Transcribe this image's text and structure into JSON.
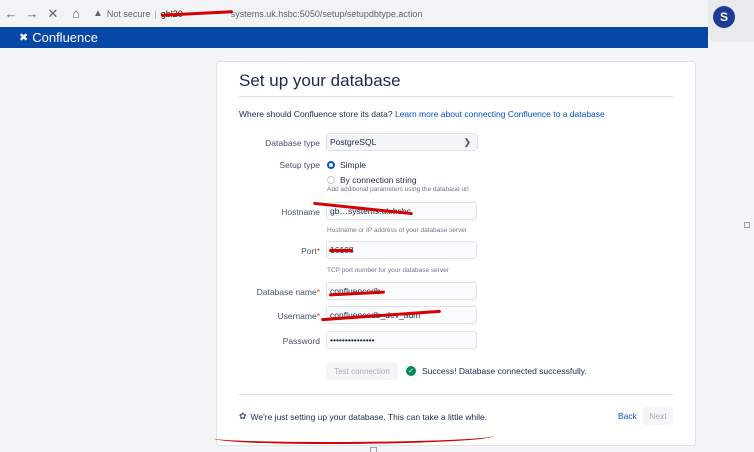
{
  "browser": {
    "back_icon": "arrow-left",
    "forward_icon": "arrow-right",
    "stop_icon": "close",
    "home_icon": "home",
    "not_secure": "Not secure",
    "url_redacted_prefix": "gbl20",
    "url_rest": "systems.uk.hsbc:5050/setup/setupdbtype.action",
    "extension_letter": "S"
  },
  "app": {
    "name": "Confluence",
    "brand_color": "#0747a6"
  },
  "page": {
    "title": "Set up your database",
    "intro": "Where should Confluence store its data?",
    "intro_link": "Learn more about connecting Confluence to a database"
  },
  "form": {
    "db_type": {
      "label": "Database type",
      "value": "PostgreSQL"
    },
    "setup_type": {
      "label": "Setup type",
      "options": [
        "Simple",
        "By connection string"
      ],
      "selected": "Simple",
      "connection_hint": "Add additional parameters using the database url"
    },
    "hostname": {
      "label": "Hostname",
      "value": "gb…systems.uk.hsbc",
      "hint": "Hostname or IP address of your database server"
    },
    "port": {
      "label": "Port",
      "value": "16108",
      "hint": "TCP port number for your database server"
    },
    "db_name": {
      "label": "Database name",
      "value": "confluencedb"
    },
    "username": {
      "label": "Username",
      "value": "confluencedb_dev_adm"
    },
    "password": {
      "label": "Password",
      "value": "•••••••••••••••"
    },
    "required_marker": "*"
  },
  "actions": {
    "test_connection": "Test connection",
    "success_message": "Success! Database connected successfully.",
    "progress_message": "We're just setting up your database. This can take a little while.",
    "back": "Back",
    "next": "Next"
  }
}
